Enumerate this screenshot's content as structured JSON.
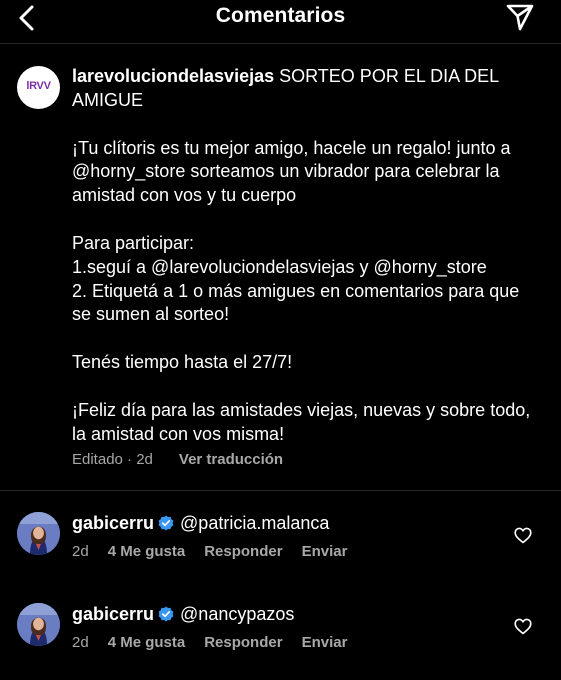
{
  "header": {
    "title": "Comentarios",
    "back_icon": "chevron-left-icon",
    "send_icon": "paper-plane-icon"
  },
  "caption": {
    "avatar_text": "lRVV",
    "username": "larevoluciondelasviejas",
    "title_text": "SORTEO POR EL DIA DEL AMIGUE",
    "paragraph_1": "¡Tu clítoris es tu mejor amigo, hacele un regalo! junto a @horny_store sorteamos un vibrador para celebrar la amistad con vos y tu cuerpo",
    "how_to_title": "Para participar:",
    "step_1": "1.seguí a  @larevoluciondelasviejas y @horny_store",
    "step_2": "2. Etiquetá a 1 o más amigues en comentarios para que se sumen al sorteo!",
    "deadline": "Tenés tiempo hasta el 27/7!",
    "closing": "¡Feliz día para las amistades viejas, nuevas y sobre todo, la amistad con vos misma!",
    "meta_edited": "Editado · 2d",
    "meta_translate": "Ver traducción"
  },
  "comments": [
    {
      "username": "gabicerru",
      "text": "@patricia.malanca",
      "time": "2d",
      "likes": "4 Me gusta",
      "reply": "Responder",
      "send": "Enviar"
    },
    {
      "username": "gabicerru",
      "text": "@nancypazos",
      "time": "2d",
      "likes": "4 Me gusta",
      "reply": "Responder",
      "send": "Enviar"
    }
  ],
  "colors": {
    "background": "#000000",
    "text": "#ffffff",
    "muted": "#a8a8a8",
    "verified": "#3897f0",
    "divider": "#262626"
  }
}
